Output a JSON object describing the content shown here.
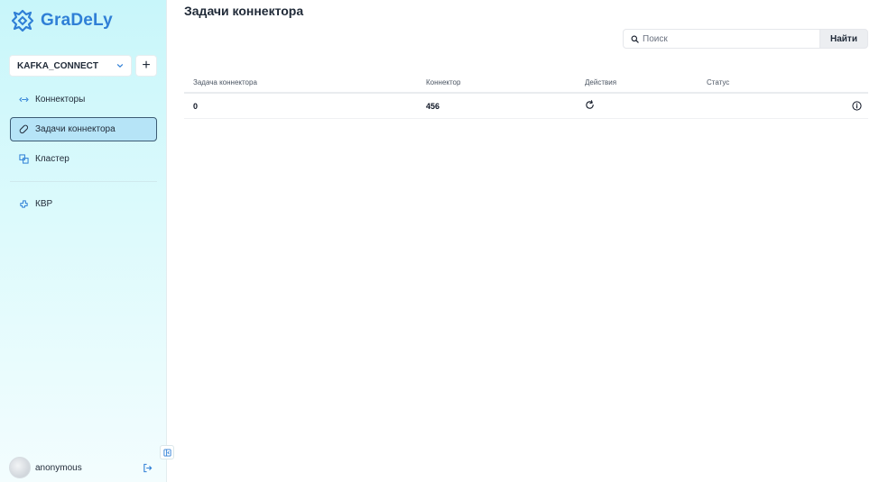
{
  "brand": {
    "name": "GraDeLy",
    "color": "#2f7fd6"
  },
  "sidebar": {
    "cluster_select": {
      "value": "KAFKA_CONNECT",
      "add_label": "+"
    },
    "items": [
      {
        "label": "Коннекторы",
        "icon": "connector-icon"
      },
      {
        "label": "Задачи коннектора",
        "icon": "link-icon",
        "active": true
      },
      {
        "label": "Кластер",
        "icon": "cluster-icon"
      }
    ],
    "items2": [
      {
        "label": "КВР",
        "icon": "puzzle-icon"
      }
    ],
    "user": {
      "name": "anonymous"
    }
  },
  "main": {
    "title": "Задачи коннектора",
    "search": {
      "placeholder": "Поиск",
      "button_label": "Найти"
    },
    "table": {
      "headers": [
        "Задача коннектора",
        "Коннектор",
        "Действия",
        "Статус"
      ],
      "rows": [
        {
          "task": "0",
          "connector": "456",
          "action_icon": "refresh-icon",
          "status_icon": "info-icon"
        }
      ]
    }
  },
  "colors": {
    "accent": "#2f7fd6",
    "active_bg": "#b6e4f7",
    "active_border": "#3c5b74"
  }
}
